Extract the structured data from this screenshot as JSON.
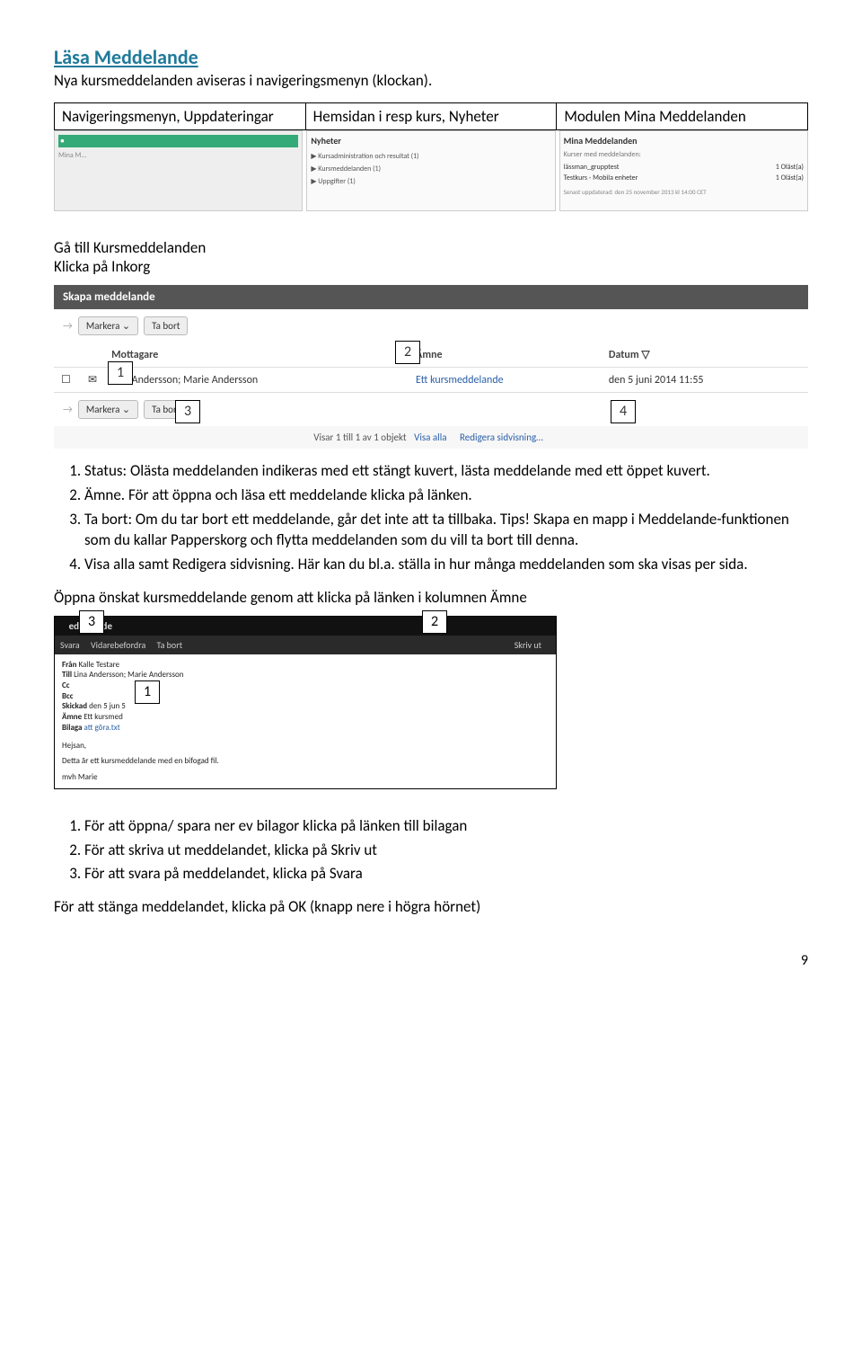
{
  "title": "Läsa Meddelande",
  "intro": "Nya kursmeddelanden aviseras i navigeringsmenyn (klockan).",
  "col3": {
    "a": "Navigeringsmenyn, Uppdateringar",
    "b": "Hemsidan i resp kurs, Nyheter",
    "c": "Modulen Mina Meddelanden"
  },
  "thumbs": {
    "b_head": "Nyheter",
    "b_items": [
      "▶ Kursadministration och resultat (1)",
      "▶ Kursmeddelanden (1)",
      "▶ Uppgifter (1)"
    ],
    "c_head": "Mina Meddelanden",
    "c_sub": "Kurser med meddelanden:",
    "c_rows": [
      {
        "name": "lässman_grupptest",
        "val": "1 Oläst(a)"
      },
      {
        "name": "Testkurs - Mobila enheter",
        "val": "1 Oläst(a)"
      }
    ],
    "c_footer": "Senast uppdaterad: den 25 november 2013 kl 14:00 CET"
  },
  "goto": "Gå till Kursmeddelanden",
  "klicka": "Klicka på Inkorg",
  "shot1": {
    "bar": "Skapa meddelande",
    "markera": "Markera",
    "tabort": "Ta bort",
    "th": {
      "mott": "Mottagare",
      "amne": "Ämne",
      "datum": "Datum"
    },
    "row": {
      "mott": "Lina Andersson; Marie Andersson",
      "amne": "Ett kursmeddelande",
      "datum": "den 5 juni 2014 11:55"
    },
    "footer_count": "Visar 1 till 1 av 1 objekt",
    "visa": "Visa alla",
    "red": "Redigera sidvisning…"
  },
  "boxes": {
    "1": "1",
    "2": "2",
    "3": "3",
    "4": "4"
  },
  "list1": [
    "Status: Olästa meddelanden indikeras med ett stängt kuvert, lästa meddelande med ett öppet kuvert.",
    "Ämne. För att öppna och läsa ett meddelande klicka på länken.",
    "Ta bort: Om du tar bort ett meddelande, går det inte att ta tillbaka. Tips! Skapa en mapp i Meddelande-funktionen som du kallar Papperskorg och flytta meddelanden som du vill ta bort till denna.",
    "Visa alla samt Redigera sidvisning. Här kan du bl.a. ställa in hur många meddelanden som ska visas per sida."
  ],
  "opna": "Öppna önskat kursmeddelande genom att klicka på länken i kolumnen Ämne",
  "shot2": {
    "title_left": "eddelande",
    "svara": "Svara",
    "vidare": "Vidarebefordra",
    "tabort": "Ta bort",
    "skriv": "Skriv ut",
    "fran_l": "Från",
    "fran_v": "Kalle Testare",
    "till_l": "Till",
    "till_v": "Lina Andersson; Marie Andersson",
    "cc_l": "Cc",
    "bcc_l": "Bcc",
    "skick_l": "Skickad",
    "skick_v": "den 5 jun     5",
    "amne_l": "Ämne",
    "amne_v": "Ett kursmed",
    "bilaga_l": "Bilaga",
    "bilaga_v": "att göra.txt",
    "hejsan": "Hejsan,",
    "body": "Detta är ett kursmeddelande med en bifogad fil.",
    "sign": "mvh Marie"
  },
  "boxes2": {
    "1": "1",
    "2": "2",
    "3": "3"
  },
  "list2": [
    "För att öppna/ spara ner ev bilagor klicka på länken till bilagan",
    "För att skriva ut meddelandet, klicka på Skriv ut",
    "För att svara på meddelandet, klicka på Svara"
  ],
  "close": "För att stänga meddelandet, klicka på OK (knapp nere i högra hörnet)",
  "pagenum": "9"
}
